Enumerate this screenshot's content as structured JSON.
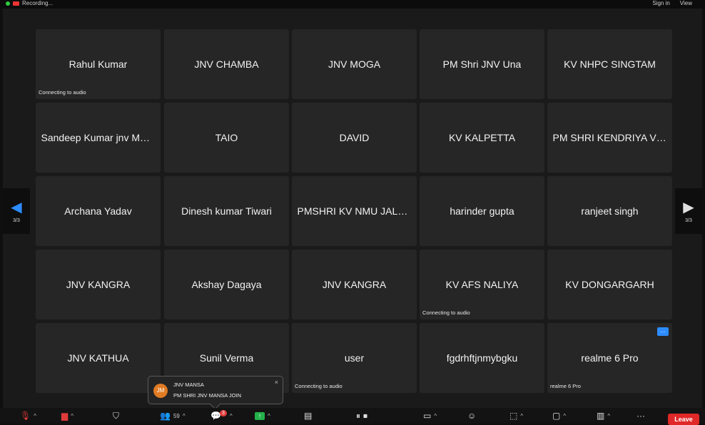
{
  "topbar": {
    "recording_label": "Recording...",
    "sign_in": "Sign in",
    "view": "View"
  },
  "nav": {
    "left_page": "3/3",
    "right_page": "3/3"
  },
  "participants": [
    {
      "name": "Rahul Kumar",
      "status": "Connecting to audio"
    },
    {
      "name": "JNV CHAMBA",
      "status": ""
    },
    {
      "name": "JNV MOGA",
      "status": ""
    },
    {
      "name": "PM Shri JNV Una",
      "status": ""
    },
    {
      "name": "KV NHPC SINGTAM",
      "status": ""
    },
    {
      "name": "Sandeep Kumar jnv Moga",
      "status": ""
    },
    {
      "name": "TAIO",
      "status": ""
    },
    {
      "name": "DAVID",
      "status": ""
    },
    {
      "name": "KV KALPETTA",
      "status": ""
    },
    {
      "name": "PM SHRI KENDRIYA VID...",
      "status": ""
    },
    {
      "name": "Archana Yadav",
      "status": ""
    },
    {
      "name": "Dinesh kumar Tiwari",
      "status": ""
    },
    {
      "name": "PMSHRI KV NMU JALG...",
      "status": ""
    },
    {
      "name": "harinder gupta",
      "status": ""
    },
    {
      "name": "ranjeet singh",
      "status": ""
    },
    {
      "name": "JNV KANGRA",
      "status": ""
    },
    {
      "name": "Akshay Dagaya",
      "status": ""
    },
    {
      "name": "JNV KANGRA",
      "status": ""
    },
    {
      "name": "KV AFS NALIYA",
      "status": "Connecting to audio"
    },
    {
      "name": "KV DONGARGARH",
      "status": ""
    },
    {
      "name": "JNV KATHUA",
      "status": ""
    },
    {
      "name": "Sunil Verma",
      "status": ""
    },
    {
      "name": "user",
      "status": "Connecting to audio"
    },
    {
      "name": "fgdrhftjnmybgku",
      "status": ""
    },
    {
      "name": "realme 6 Pro",
      "status": "realme 6 Pro",
      "more": "..."
    }
  ],
  "chat_toast": {
    "initials": "JM",
    "sender": "JNV MANSA",
    "message": "PM SHRI JNV MANSA JOIN"
  },
  "toolbar": {
    "participant_count": "59",
    "chat_badge": "3",
    "leave_label": "Leave"
  }
}
